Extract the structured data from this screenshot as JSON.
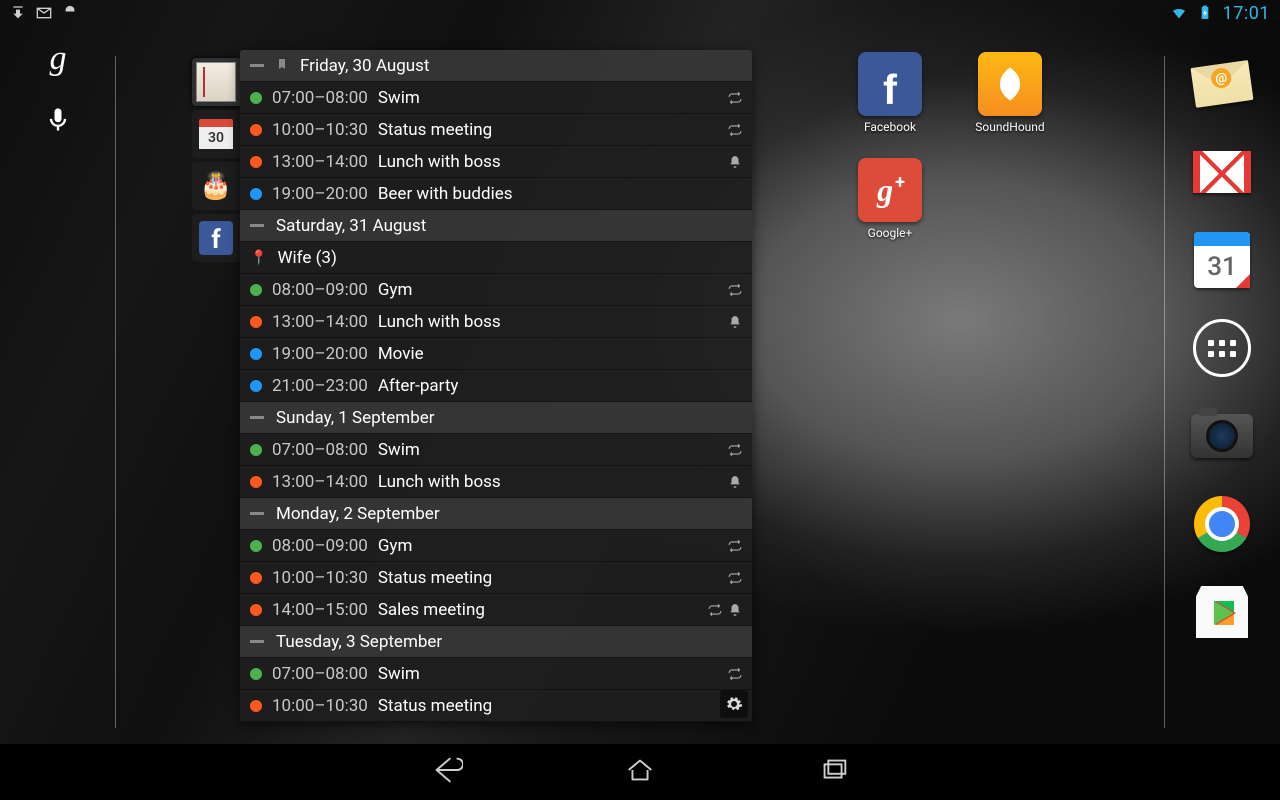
{
  "status": {
    "clock": "17:01"
  },
  "left": {
    "g": "g"
  },
  "widget": {
    "tabs": {
      "calendar_number": "30"
    },
    "days": [
      {
        "label": "Friday, 30 August",
        "bookmark": true,
        "events": [
          {
            "color": "#4caf50",
            "time": "07:00–08:00",
            "title": "Swim",
            "repeat": true,
            "alarm": false
          },
          {
            "color": "#ff5722",
            "time": "10:00–10:30",
            "title": "Status meeting",
            "repeat": true,
            "alarm": false
          },
          {
            "color": "#ff5722",
            "time": "13:00–14:00",
            "title": "Lunch with boss",
            "repeat": false,
            "alarm": true
          },
          {
            "color": "#2196f3",
            "time": "19:00–20:00",
            "title": "Beer with buddies",
            "repeat": false,
            "alarm": false
          }
        ]
      },
      {
        "label": "Saturday, 31 August",
        "events": [
          {
            "color": "#29b6f6",
            "time": "",
            "title": "Wife (3)",
            "repeat": false,
            "alarm": false,
            "special": "pin"
          },
          {
            "color": "#4caf50",
            "time": "08:00–09:00",
            "title": "Gym",
            "repeat": true,
            "alarm": false
          },
          {
            "color": "#ff5722",
            "time": "13:00–14:00",
            "title": "Lunch with boss",
            "repeat": false,
            "alarm": true
          },
          {
            "color": "#2196f3",
            "time": "19:00–20:00",
            "title": "Movie",
            "repeat": false,
            "alarm": false
          },
          {
            "color": "#2196f3",
            "time": "21:00–23:00",
            "title": "After-party",
            "repeat": false,
            "alarm": false
          }
        ]
      },
      {
        "label": "Sunday, 1 September",
        "events": [
          {
            "color": "#4caf50",
            "time": "07:00–08:00",
            "title": "Swim",
            "repeat": true,
            "alarm": false
          },
          {
            "color": "#ff5722",
            "time": "13:00–14:00",
            "title": "Lunch with boss",
            "repeat": false,
            "alarm": true
          }
        ]
      },
      {
        "label": "Monday, 2 September",
        "events": [
          {
            "color": "#4caf50",
            "time": "08:00–09:00",
            "title": "Gym",
            "repeat": true,
            "alarm": false
          },
          {
            "color": "#ff5722",
            "time": "10:00–10:30",
            "title": "Status meeting",
            "repeat": true,
            "alarm": false
          },
          {
            "color": "#ff5722",
            "time": "14:00–15:00",
            "title": "Sales meeting",
            "repeat": true,
            "alarm": true
          }
        ]
      },
      {
        "label": "Tuesday, 3 September",
        "events": [
          {
            "color": "#4caf50",
            "time": "07:00–08:00",
            "title": "Swim",
            "repeat": true,
            "alarm": false
          },
          {
            "color": "#ff5722",
            "time": "10:00–10:30",
            "title": "Status meeting",
            "repeat": false,
            "alarm": false
          }
        ]
      }
    ]
  },
  "home_icons": [
    {
      "id": "facebook",
      "label": "Facebook"
    },
    {
      "id": "soundhound",
      "label": "SoundHound"
    },
    {
      "id": "googleplus",
      "label": "Google+"
    }
  ],
  "dock": {
    "calendar_day": "31"
  }
}
